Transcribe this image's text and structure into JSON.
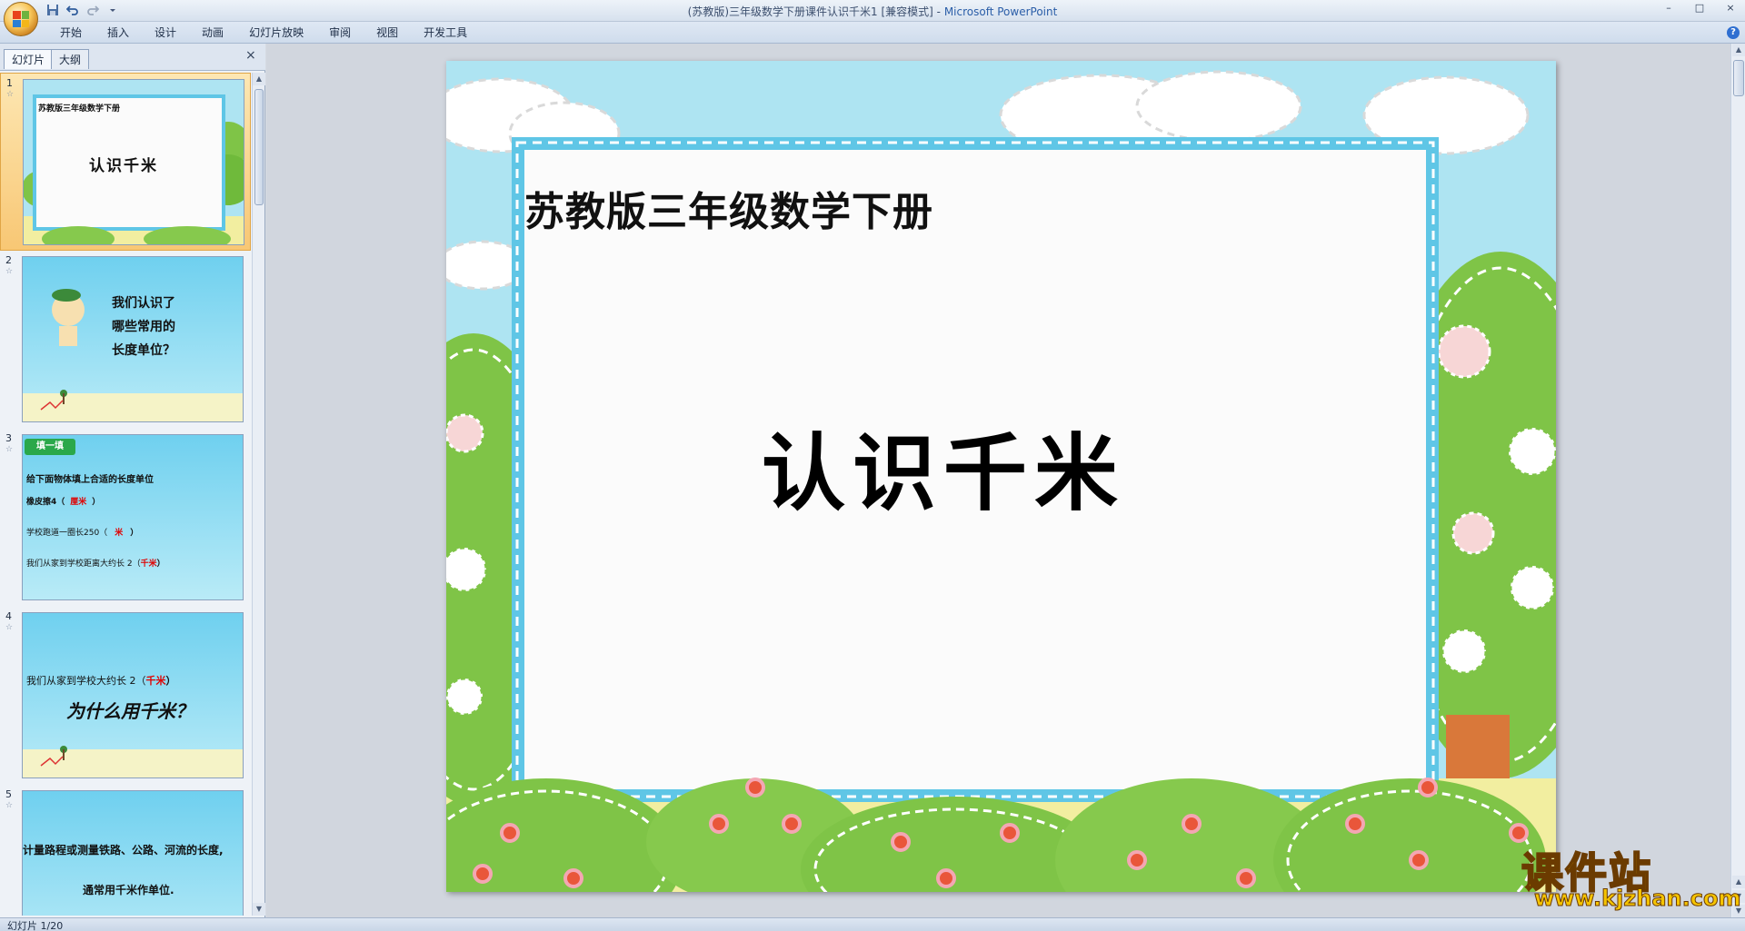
{
  "window": {
    "title_prefix": "(苏教版)三年级数学下册课件认识千米1 [兼容模式] - ",
    "app_name": "Microsoft PowerPoint",
    "minimize": "–",
    "restore": "□",
    "close": "×"
  },
  "ribbon": {
    "tabs": [
      "开始",
      "插入",
      "设计",
      "动画",
      "幻灯片放映",
      "审阅",
      "视图",
      "开发工具"
    ],
    "help": "?"
  },
  "left_pane": {
    "tabs": [
      "幻灯片",
      "大纲"
    ],
    "close": "×",
    "slides": [
      {
        "number": "1",
        "title": "苏教版三年级数学下册",
        "main": "认识千米"
      },
      {
        "number": "2",
        "line1": "我们认识了",
        "line2": "哪些常用的",
        "line3": "长度单位？"
      },
      {
        "number": "3",
        "badge": "填一填",
        "heading": "给下面物体填上合适的长度单位",
        "q1": "橡皮擦4（",
        "a1": "厘米",
        "q1_end": "）",
        "q2": "学校跑道一圈长250（",
        "a2": "米",
        "q2_end": "）",
        "q3": "我们从家到学校距离大约长 2（",
        "a3": "千米",
        "q3_end": "）"
      },
      {
        "number": "4",
        "line1": "我们从家到学校大约长 2（",
        "answer": "千米",
        "line1_end": "）",
        "line2": "为什么用千米？"
      },
      {
        "number": "5",
        "line1": "计量路程或测量铁路、公路、河流的长度,",
        "line2": "通常用千米作单位."
      }
    ]
  },
  "slide": {
    "title": "苏教版三年级数学下册",
    "main": "认识千米"
  },
  "status": {
    "slide_counter": "幻灯片 1/20"
  },
  "watermark": {
    "name": "课件站",
    "url": "www.kjzhan.com"
  },
  "colors": {
    "sky": "#aee4f2",
    "grass": "#f2eea0",
    "frame": "#5fc6e6",
    "tree": "#7fc447",
    "selection": "#f8c774"
  }
}
